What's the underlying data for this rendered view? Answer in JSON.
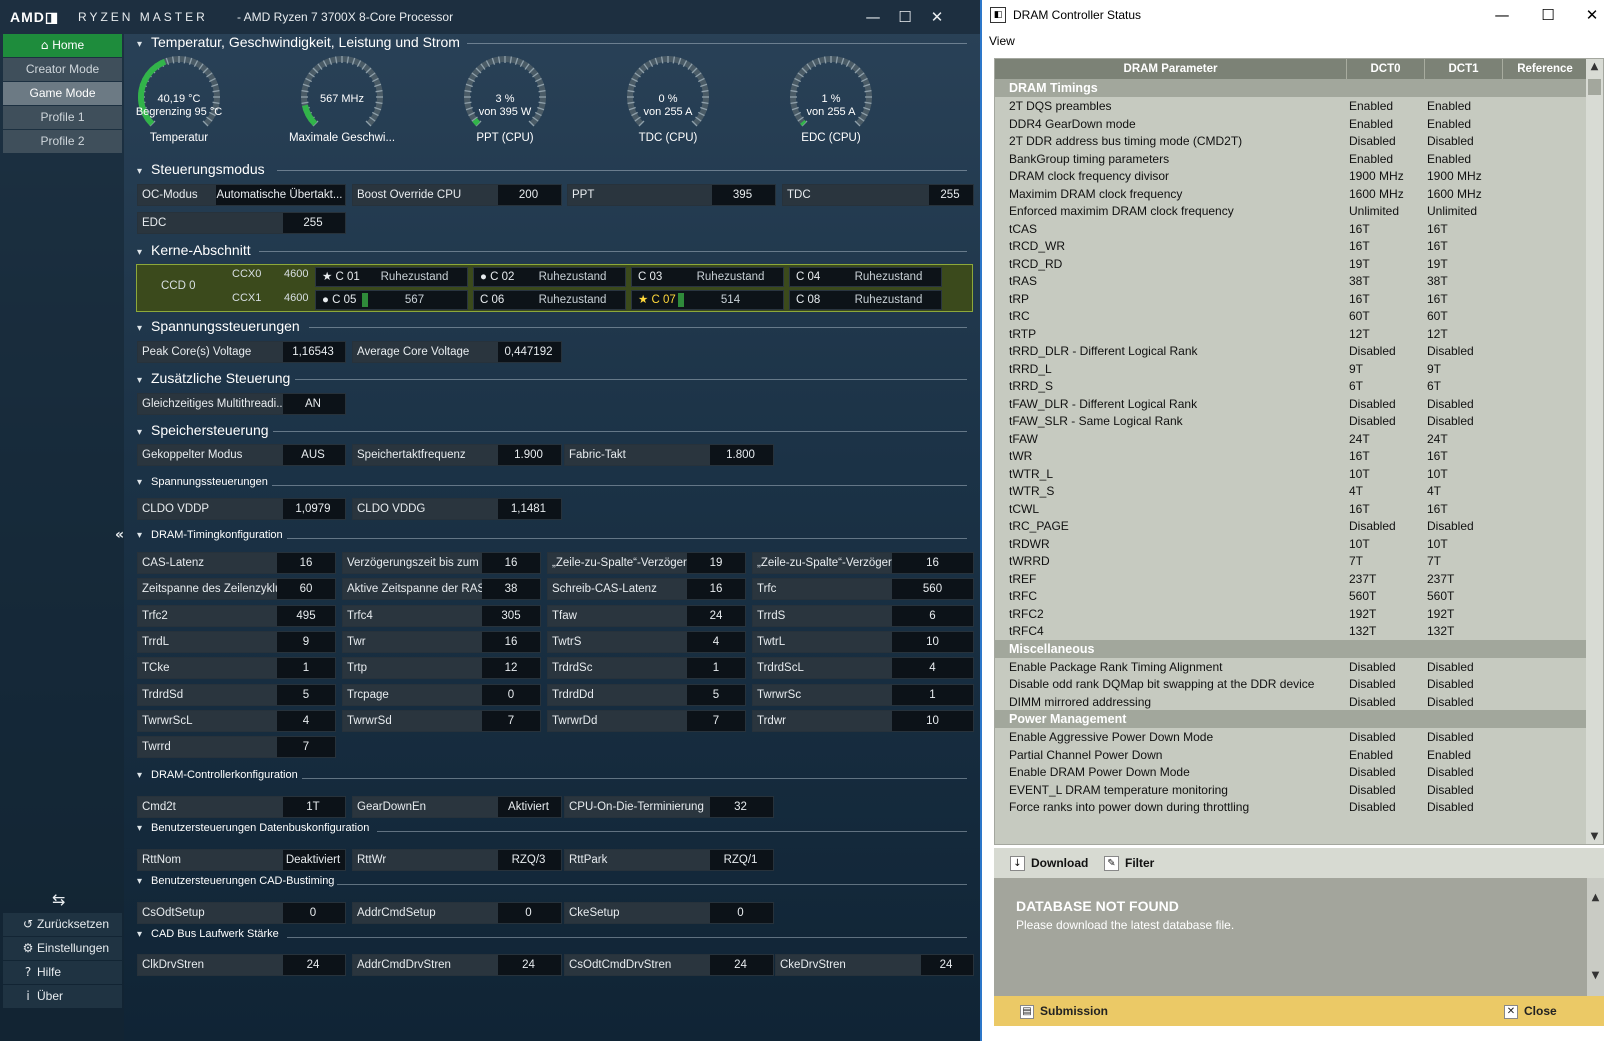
{
  "rm": {
    "logo": "AMD◨",
    "product": "RYZEN MASTER",
    "cpu": "-  AMD Ryzen 7 3700X 8-Core Processor",
    "nav": [
      {
        "label": "Home"
      },
      {
        "label": "Creator Mode"
      },
      {
        "label": "Game Mode"
      },
      {
        "label": "Profile 1"
      },
      {
        "label": "Profile 2"
      }
    ],
    "bottom": [
      {
        "label": "Zurücksetzen",
        "icon": "reset-icon"
      },
      {
        "label": "Einstellungen",
        "icon": "gears-icon"
      },
      {
        "label": "Hilfe",
        "icon": "help-icon"
      },
      {
        "label": "Über",
        "icon": "info-icon"
      }
    ],
    "gauges": [
      {
        "l1": "40,19 °C",
        "l2": "Begrenzing  95 °C",
        "label": "Temperatur",
        "level": 0.42
      },
      {
        "l1": "567  MHz",
        "l2": "",
        "label": "Maximale Geschwi...",
        "level": 0.12
      },
      {
        "l1": "3 %",
        "l2": "von  395 W",
        "label": "PPT (CPU)",
        "level": 0.03
      },
      {
        "l1": "0 %",
        "l2": "von  255 A",
        "label": "TDC (CPU)",
        "level": 0.0
      },
      {
        "l1": "1 %",
        "l2": "von  255 A",
        "label": "EDC (CPU)",
        "level": 0.01
      }
    ],
    "sections": {
      "s1": "Temperatur, Geschwindigkeit, Leistung und Strom",
      "s2": "Steuerungsmodus",
      "s3": "Kerne-Abschnitt",
      "s4": "Spannungssteuerungen",
      "s5": "Zusätzliche Steuerung",
      "s6": "Speichersteuerung",
      "s7": "Spannungssteuerungen",
      "s8": "DRAM-Timingkonfiguration",
      "s9": "DRAM-Controllerkonfiguration",
      "s10": "Benutzersteuerungen Datenbuskonfiguration",
      "s11": "Benutzersteuerungen CAD-Bustiming",
      "s12": "CAD Bus Laufwerk Stärke"
    },
    "ccd": {
      "name": "CCD 0",
      "ccx0": "CCX0",
      "ccx0_freq": "4600",
      "ccx1": "CCX1",
      "ccx1_freq": "4600",
      "cores": [
        {
          "name": "C 01",
          "state": "Ruhezustand",
          "mark": "★"
        },
        {
          "name": "C 02",
          "state": "Ruhezustand",
          "mark": "●"
        },
        {
          "name": "C 03",
          "state": "Ruhezustand",
          "mark": ""
        },
        {
          "name": "C 04",
          "state": "Ruhezustand",
          "mark": ""
        },
        {
          "name": "C 05",
          "state": "567",
          "mark": "●"
        },
        {
          "name": "C 06",
          "state": "Ruhezustand",
          "mark": ""
        },
        {
          "name": "C 07",
          "state": "514",
          "mark": "★"
        },
        {
          "name": "C 08",
          "state": "Ruhezustand",
          "mark": ""
        }
      ]
    },
    "ctrl": {
      "oc_label": "OC-Modus",
      "oc_value": "Automatische Übertakt...",
      "boost_label": "Boost Override CPU",
      "boost_value": "200",
      "ppt_label": "PPT",
      "ppt_value": "395",
      "tdc_label": "TDC",
      "tdc_value": "255",
      "edc_label": "EDC",
      "edc_value": "255"
    },
    "volt": {
      "peak_label": "Peak Core(s) Voltage",
      "peak_value": "1,16543",
      "avg_label": "Average Core Voltage",
      "avg_value": "0,447192"
    },
    "extra": {
      "smt_label": "Gleichzeitiges Multithreadi...",
      "smt_value": "AN"
    },
    "mem": {
      "coupled_label": "Gekoppelter Modus",
      "coupled_value": "AUS",
      "freq_label": "Speichertaktfrequenz",
      "freq_value": "1.900",
      "fabric_label": "Fabric-Takt",
      "fabric_value": "1.800"
    },
    "memvolt": {
      "vddp_label": "CLDO VDDP",
      "vddp_value": "1,0979",
      "vddg_label": "CLDO VDDG",
      "vddg_value": "1,1481"
    },
    "timings": [
      [
        "CAS-Latenz",
        "16",
        "Verzögerungszeit bis zum ...",
        "16",
        "„Zeile-zu-Spalte“-Verzöger...",
        "19",
        "„Zeile-zu-Spalte“-Verzöger...",
        "16"
      ],
      [
        "Zeitspanne des Zeilenzyklus",
        "60",
        "Aktive Zeitspanne der RAS",
        "38",
        "Schreib-CAS-Latenz",
        "16",
        "Trfc",
        "560"
      ],
      [
        "Trfc2",
        "495",
        "Trfc4",
        "305",
        "Tfaw",
        "24",
        "TrrdS",
        "6"
      ],
      [
        "TrrdL",
        "9",
        "Twr",
        "16",
        "TwtrS",
        "4",
        "TwtrL",
        "10"
      ],
      [
        "TCke",
        "1",
        "Trtp",
        "12",
        "TrdrdSc",
        "1",
        "TrdrdScL",
        "4"
      ],
      [
        "TrdrdSd",
        "5",
        "Trcpage",
        "0",
        "TrdrdDd",
        "5",
        "TwrwrSc",
        "1"
      ],
      [
        "TwrwrScL",
        "4",
        "TwrwrSd",
        "7",
        "TwrwrDd",
        "7",
        "Trdwr",
        "10"
      ],
      [
        "Twrrd",
        "7"
      ]
    ],
    "ctrlcfg": {
      "cmd_label": "Cmd2t",
      "cmd_value": "1T",
      "gd_label": "GearDownEn",
      "gd_value": "Aktiviert",
      "odt_label": "CPU-On-Die-Terminierung",
      "odt_value": "32"
    },
    "databus": {
      "nom_label": "RttNom",
      "nom_value": "Deaktiviert",
      "wr_label": "RttWr",
      "wr_value": "RZQ/3",
      "park_label": "RttPark",
      "park_value": "RZQ/1"
    },
    "cadtiming": {
      "csodt_label": "CsOdtSetup",
      "csodt_value": "0",
      "addr_label": "AddrCmdSetup",
      "addr_value": "0",
      "cke_label": "CkeSetup",
      "cke_value": "0"
    },
    "caddrv": {
      "clk_label": "ClkDrvStren",
      "clk_value": "24",
      "addr_label": "AddrCmdDrvStren",
      "addr_value": "24",
      "cs_label": "CsOdtCmdDrvStren",
      "cs_value": "24",
      "cke_label": "CkeDrvStren",
      "cke_value": "24"
    }
  },
  "dram": {
    "title": "DRAM Controller Status",
    "menu": "View",
    "headers": [
      "DRAM Parameter",
      "DCT0",
      "DCT1",
      "Reference"
    ],
    "groups": [
      {
        "name": "DRAM Timings",
        "rows": [
          [
            "2T DQS preambles",
            "Enabled",
            "Enabled"
          ],
          [
            "DDR4 GearDown mode",
            "Enabled",
            "Enabled"
          ],
          [
            "2T DDR address bus timing mode (CMD2T)",
            "Disabled",
            "Disabled"
          ],
          [
            "BankGroup timing parameters",
            "Enabled",
            "Enabled"
          ],
          [
            "DRAM clock frequency divisor",
            "1900 MHz",
            "1900 MHz"
          ],
          [
            "Maximim DRAM clock frequency",
            "1600 MHz",
            "1600 MHz"
          ],
          [
            "Enforced maximim DRAM clock frequency",
            "Unlimited",
            "Unlimited"
          ],
          [
            "tCAS",
            "16T",
            "16T"
          ],
          [
            "tRCD_WR",
            "16T",
            "16T"
          ],
          [
            "tRCD_RD",
            "19T",
            "19T"
          ],
          [
            "tRAS",
            "38T",
            "38T"
          ],
          [
            "tRP",
            "16T",
            "16T"
          ],
          [
            "tRC",
            "60T",
            "60T"
          ],
          [
            "tRTP",
            "12T",
            "12T"
          ],
          [
            "tRRD_DLR - Different Logical Rank",
            "Disabled",
            "Disabled"
          ],
          [
            "tRRD_L",
            "9T",
            "9T"
          ],
          [
            "tRRD_S",
            "6T",
            "6T"
          ],
          [
            "tFAW_DLR - Different Logical Rank",
            "Disabled",
            "Disabled"
          ],
          [
            "tFAW_SLR - Same Logical Rank",
            "Disabled",
            "Disabled"
          ],
          [
            "tFAW",
            "24T",
            "24T"
          ],
          [
            "tWR",
            "16T",
            "16T"
          ],
          [
            "tWTR_L",
            "10T",
            "10T"
          ],
          [
            "tWTR_S",
            "4T",
            "4T"
          ],
          [
            "tCWL",
            "16T",
            "16T"
          ],
          [
            "tRC_PAGE",
            "Disabled",
            "Disabled"
          ],
          [
            "tRDWR",
            "10T",
            "10T"
          ],
          [
            "tWRRD",
            "7T",
            "7T"
          ],
          [
            "tREF",
            "237T",
            "237T"
          ],
          [
            "tRFC",
            "560T",
            "560T"
          ],
          [
            "tRFC2",
            "192T",
            "192T"
          ],
          [
            "tRFC4",
            "132T",
            "132T"
          ]
        ]
      },
      {
        "name": "Miscellaneous",
        "rows": [
          [
            "Enable Package Rank Timing Alignment",
            "Disabled",
            "Disabled"
          ],
          [
            "Disable odd rank DQMap bit swapping at the DDR device",
            "Disabled",
            "Disabled"
          ],
          [
            "DIMM mirrored addressing",
            "Disabled",
            "Disabled"
          ]
        ]
      },
      {
        "name": "Power Management",
        "rows": [
          [
            "Enable Aggressive Power Down Mode",
            "Disabled",
            "Disabled"
          ],
          [
            "Partial Channel Power Down",
            "Enabled",
            "Enabled"
          ],
          [
            "Enable DRAM Power Down Mode",
            "Disabled",
            "Disabled"
          ],
          [
            "EVENT_L DRAM temperature monitoring",
            "Disabled",
            "Disabled"
          ],
          [
            "Force ranks into power down during throttling",
            "Disabled",
            "Disabled"
          ]
        ]
      }
    ],
    "toolbar": {
      "download": "Download",
      "filter": "Filter"
    },
    "msg": {
      "title": "DATABASE NOT FOUND",
      "text": "Please download the latest database file."
    },
    "footer": {
      "submission": "Submission",
      "close": "Close"
    },
    "colors": {
      "accent": "#ebc966",
      "header": "#7c8276",
      "category": "#a2a79c"
    }
  }
}
